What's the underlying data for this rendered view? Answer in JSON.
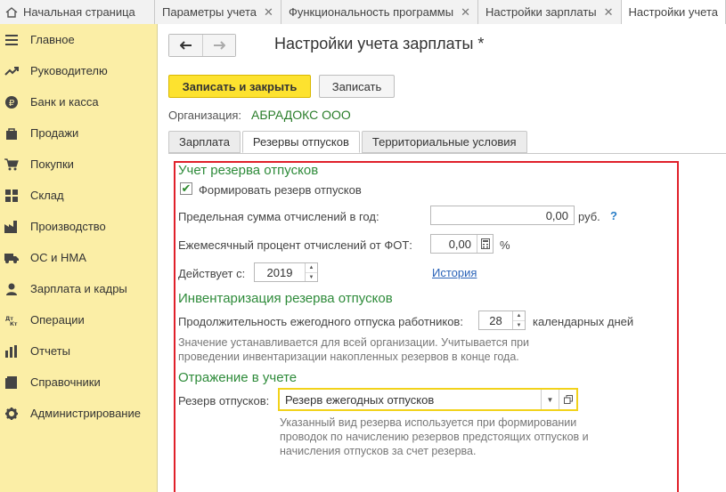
{
  "top_tabs": [
    {
      "label": "Начальная страница"
    },
    {
      "label": "Параметры учета"
    },
    {
      "label": "Функциональность программы"
    },
    {
      "label": "Настройки зарплаты"
    },
    {
      "label": "Настройки учета"
    }
  ],
  "sidebar": {
    "items": [
      {
        "label": "Главное",
        "icon": "menu-icon"
      },
      {
        "label": "Руководителю",
        "icon": "trend-icon"
      },
      {
        "label": "Банк и касса",
        "icon": "ruble-icon"
      },
      {
        "label": "Продажи",
        "icon": "bag-icon"
      },
      {
        "label": "Покупки",
        "icon": "cart-icon"
      },
      {
        "label": "Склад",
        "icon": "grid-icon"
      },
      {
        "label": "Производство",
        "icon": "factory-icon"
      },
      {
        "label": "ОС и НМА",
        "icon": "truck-icon"
      },
      {
        "label": "Зарплата и кадры",
        "icon": "person-icon"
      },
      {
        "label": "Операции",
        "icon": "dt-kt-icon"
      },
      {
        "label": "Отчеты",
        "icon": "report-icon"
      },
      {
        "label": "Справочники",
        "icon": "book-icon"
      },
      {
        "label": "Администрирование",
        "icon": "gear-icon"
      }
    ]
  },
  "header": {
    "title": "Настройки учета зарплаты *",
    "back_glyph": "🡐",
    "forward_glyph": "🡒"
  },
  "toolbar": {
    "save_close_label": "Записать и закрыть",
    "save_label": "Записать"
  },
  "organization": {
    "label": "Организация:",
    "value": "АБРАДОКС ООО"
  },
  "form_tabs": [
    {
      "label": "Зарплата"
    },
    {
      "label": "Резервы отпусков"
    },
    {
      "label": "Территориальные условия"
    }
  ],
  "reserve": {
    "section_title": "Учет резерва отпусков",
    "checkbox_label": "Формировать резерв отпусков",
    "limit_label": "Предельная сумма отчислений в год:",
    "limit_value": "0,00",
    "limit_unit": "руб.",
    "help": "?",
    "percent_label": "Ежемесячный процент отчислений от ФОТ:",
    "percent_value": "0,00",
    "percent_unit": "%",
    "valid_from_label": "Действует с:",
    "valid_from_value": "2019",
    "history_link": "История"
  },
  "inventory": {
    "section_title": "Инвентаризация резерва отпусков",
    "duration_label": "Продолжительность ежегодного отпуска работников:",
    "duration_value": "28",
    "duration_unit": "календарных дней",
    "hint_line1": "Значение устанавливается для всей организации. Учитывается при",
    "hint_line2": "проведении инвентаризации накопленных резервов в конце года."
  },
  "accounting": {
    "section_title": "Отражение в учете",
    "reserve_label": "Резерв отпусков:",
    "reserve_value": "Резерв ежегодных отпусков",
    "hint_line1": "Указанный вид резерва используется при формировании",
    "hint_line2": "проводок по начислению резервов предстоящих отпусков и",
    "hint_line3": "начисления отпусков за счет резерва."
  }
}
